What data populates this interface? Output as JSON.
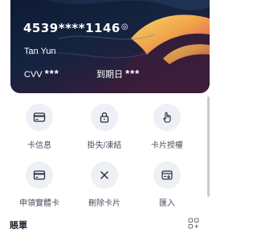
{
  "card": {
    "number": "4539****1146",
    "holder": "Tan Yun",
    "cvv_label": "CVV",
    "cvv_value": "***",
    "expiry_label": "到期日",
    "expiry_value": "***"
  },
  "actions": [
    {
      "label": "卡信息",
      "icon": "card-icon"
    },
    {
      "label": "掛失/凍結",
      "icon": "lock-icon"
    },
    {
      "label": "卡片授權",
      "icon": "hand-pointer-icon"
    },
    {
      "label": "申領實體卡",
      "icon": "card-icon"
    },
    {
      "label": "刪除卡片",
      "icon": "close-icon"
    },
    {
      "label": "匯入",
      "icon": "import-icon"
    }
  ],
  "bills": {
    "title": "賬單",
    "icon": "grid-plus-icon"
  },
  "colors": {
    "card_bg": "#0e1a33",
    "accent_gold": "#f0b84a",
    "icon_circle": "#eef0f6"
  }
}
